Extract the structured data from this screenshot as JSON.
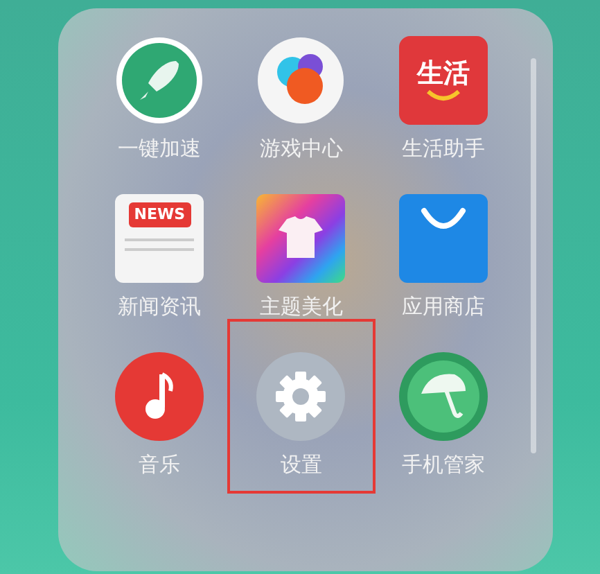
{
  "folder": {
    "apps": [
      {
        "kind": "rocket",
        "label": "一键加速",
        "highlighted": false
      },
      {
        "kind": "game",
        "label": "游戏中心",
        "highlighted": false
      },
      {
        "kind": "life",
        "label": "生活助手",
        "icon_text": "生活",
        "highlighted": false
      },
      {
        "kind": "news",
        "label": "新闻资讯",
        "icon_text": "NEWS",
        "highlighted": false
      },
      {
        "kind": "theme",
        "label": "主题美化",
        "highlighted": false
      },
      {
        "kind": "store",
        "label": "应用商店",
        "highlighted": false
      },
      {
        "kind": "music",
        "label": "音乐",
        "highlighted": false
      },
      {
        "kind": "settings",
        "label": "设置",
        "highlighted": true
      },
      {
        "kind": "guard",
        "label": "手机管家",
        "highlighted": false
      }
    ]
  }
}
